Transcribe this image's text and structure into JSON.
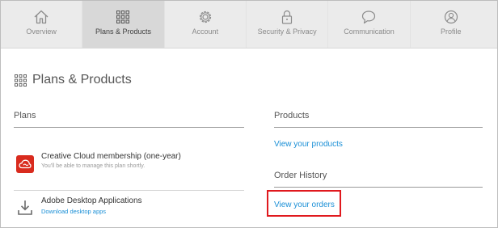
{
  "nav": {
    "items": [
      {
        "label": "Overview"
      },
      {
        "label": "Plans & Products"
      },
      {
        "label": "Account"
      },
      {
        "label": "Security & Privacy"
      },
      {
        "label": "Communication"
      },
      {
        "label": "Profile"
      }
    ],
    "active": "Plans & Products"
  },
  "page": {
    "title": "Plans & Products"
  },
  "plans": {
    "heading": "Plans",
    "items": [
      {
        "title": "Creative Cloud membership (one-year)",
        "subtitle": "You'll be able to manage this plan shortly.",
        "icon": "creative-cloud-icon"
      },
      {
        "title": "Adobe Desktop Applications",
        "link": "Download desktop apps",
        "icon": "download-icon"
      }
    ]
  },
  "products": {
    "heading": "Products",
    "link": "View your products"
  },
  "order_history": {
    "heading": "Order History",
    "link": "View your orders"
  },
  "colors": {
    "accent_link": "#1a8fd6",
    "highlight": "#e0191e",
    "cc_red": "#d92b1e"
  }
}
